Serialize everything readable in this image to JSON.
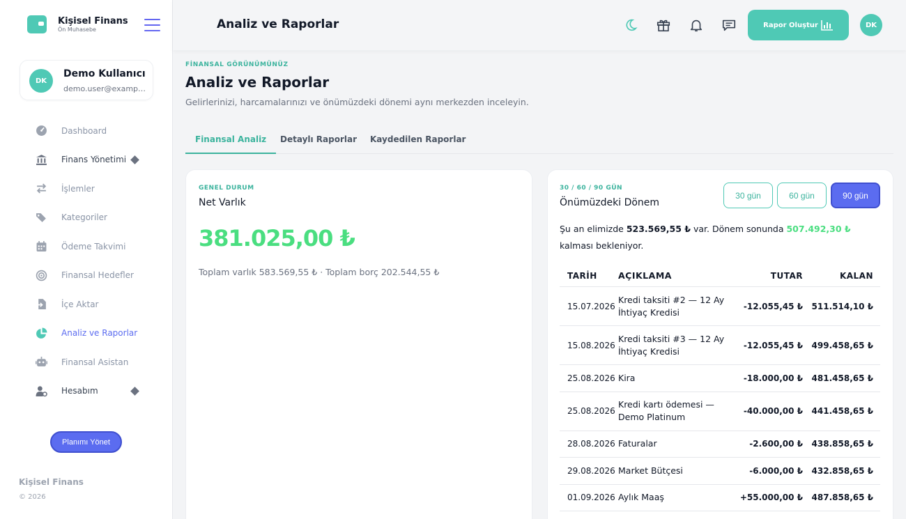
{
  "brand": {
    "title": "Kişisel Finans",
    "subtitle": "Ön Muhasebe"
  },
  "user": {
    "initials": "DK",
    "name": "Demo Kullanıcı",
    "email": "demo.user@example.com"
  },
  "nav": [
    {
      "label": "Dashboard",
      "icon": "gauge-icon"
    },
    {
      "label": "Finans Yönetimi",
      "icon": "bank-icon",
      "submenu": true
    },
    {
      "label": "İşlemler",
      "icon": "arrows-exchange-icon"
    },
    {
      "label": "Kategoriler",
      "icon": "tags-icon"
    },
    {
      "label": "Ödeme Takvimi",
      "icon": "calendar-icon"
    },
    {
      "label": "Finansal Hedefler",
      "icon": "target-icon"
    },
    {
      "label": "İçe Aktar",
      "icon": "file-import-icon"
    },
    {
      "label": "Analiz ve Raporlar",
      "icon": "pie-chart-icon",
      "active": true
    },
    {
      "label": "Finansal Asistan",
      "icon": "robot-icon"
    },
    {
      "label": "Hesabım",
      "icon": "user-cog-icon",
      "submenu": true
    }
  ],
  "plan_button": "Planımı Yönet",
  "footer": {
    "title": "Kişisel Finans",
    "copyright": "© 2026"
  },
  "topbar": {
    "title": "Analiz ve Raporlar",
    "report_button": "Rapor Oluştur",
    "avatar": "DK"
  },
  "page": {
    "eyebrow": "FİNANSAL GÖRÜNÜMÜNÜZ",
    "title": "Analiz ve Raporlar",
    "subtitle": "Gelirlerinizi, harcamalarınızı ve önümüzdeki dönemi aynı merkezden inceleyin."
  },
  "tabs": [
    "Finansal Analiz",
    "Detaylı Raporlar",
    "Kaydedilen Raporlar"
  ],
  "net_worth": {
    "eyebrow": "GENEL DURUM",
    "title": "Net Varlık",
    "value": "381.025,00 ₺",
    "detail": "Toplam varlık 583.569,55 ₺ · Toplam borç 202.544,55 ₺"
  },
  "upcoming": {
    "eyebrow": "30 / 60 / 90 GÜN",
    "title": "Önümüzdeki Dönem",
    "periods": [
      "30 gün",
      "60 gün",
      "90 gün"
    ],
    "active_period": "90 gün",
    "summary_pre": "Şu an elimizde ",
    "current": "523.569,55 ₺",
    "summary_mid": " var. Dönem sonunda ",
    "projected": "507.492,30 ₺",
    "summary_post": " kalması bekleniyor.",
    "columns": [
      "TARİH",
      "AÇIKLAMA",
      "TUTAR",
      "KALAN"
    ],
    "rows": [
      {
        "date": "15.07.2026",
        "desc": "Kredi taksiti #2 — 12 Ay İhtiyaç Kredisi",
        "amount": "-12.055,45 ₺",
        "remaining": "511.514,10 ₺"
      },
      {
        "date": "15.08.2026",
        "desc": "Kredi taksiti #3 — 12 Ay İhtiyaç Kredisi",
        "amount": "-12.055,45 ₺",
        "remaining": "499.458,65 ₺"
      },
      {
        "date": "25.08.2026",
        "desc": "Kira",
        "amount": "-18.000,00 ₺",
        "remaining": "481.458,65 ₺"
      },
      {
        "date": "25.08.2026",
        "desc": "Kredi kartı ödemesi — Demo Platinum",
        "amount": "-40.000,00 ₺",
        "remaining": "441.458,65 ₺"
      },
      {
        "date": "28.08.2026",
        "desc": "Faturalar",
        "amount": "-2.600,00 ₺",
        "remaining": "438.858,65 ₺"
      },
      {
        "date": "29.08.2026",
        "desc": "Market Bütçesi",
        "amount": "-6.000,00 ₺",
        "remaining": "432.858,65 ₺"
      },
      {
        "date": "01.09.2026",
        "desc": "Aylık Maaş",
        "amount": "+55.000,00 ₺",
        "remaining": "487.858,65 ₺"
      }
    ]
  },
  "colors": {
    "teal": "#4fc9b5",
    "indigo": "#5b6cf0",
    "green": "#4ade80"
  }
}
